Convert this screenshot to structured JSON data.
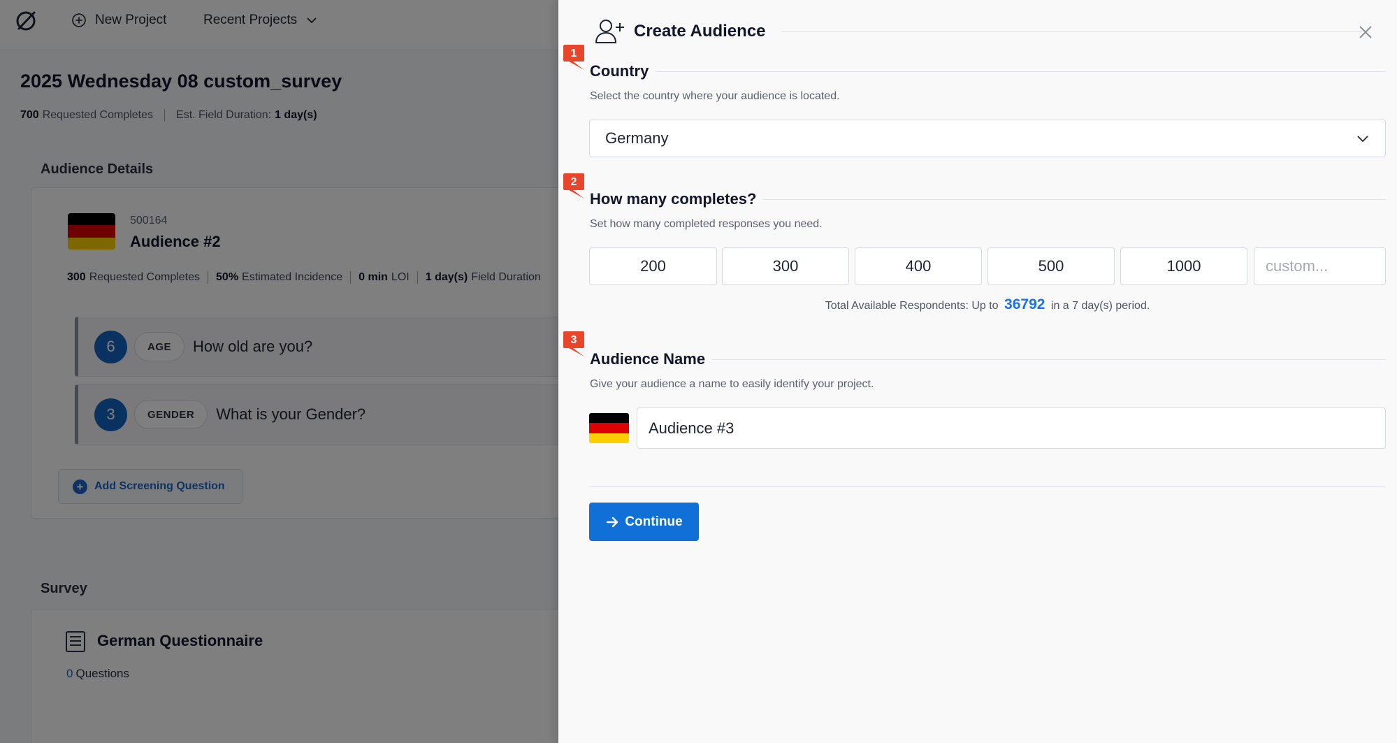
{
  "colors": {
    "primary": "#1070d8",
    "accent_number": "#1a73e8",
    "step_badge": "#e8462a",
    "overlay": "rgba(0,0,0,0.5)",
    "flag_black": "#000000",
    "flag_red": "#dd0000",
    "flag_gold": "#ffce00"
  },
  "topbar": {
    "logo_icon": "brand-logo-icon",
    "new_project_label": "New Project",
    "recent_projects_label": "Recent Projects"
  },
  "project": {
    "title": "2025 Wednesday 08 custom_survey",
    "requested_completes_value": "700",
    "requested_completes_label": "Requested Completes",
    "field_duration_label": "Est. Field Duration:",
    "field_duration_value": "1 day(s)"
  },
  "audience_details": {
    "section_label": "Audience Details",
    "id": "500164",
    "name": "Audience #2",
    "stats": [
      {
        "value": "300",
        "label": "Requested Completes"
      },
      {
        "value": "50%",
        "label": "Estimated Incidence"
      },
      {
        "value": "0 min",
        "label": "LOI"
      },
      {
        "value": "1 day(s)",
        "label": "Field Duration"
      }
    ],
    "questions": [
      {
        "count": "6",
        "tag": "AGE",
        "text": "How old are you?"
      },
      {
        "count": "3",
        "tag": "GENDER",
        "text": "What is your Gender?"
      }
    ],
    "add_question_label": "Add Screening Question"
  },
  "survey": {
    "section_label": "Survey",
    "name": "German Questionnaire",
    "question_count": "0",
    "question_label": "Questions"
  },
  "drawer": {
    "title": "Create Audience",
    "steps": [
      {
        "number": "1",
        "title": "Country",
        "description": "Select the country where your audience is located."
      },
      {
        "number": "2",
        "title": "How many completes?",
        "description": "Set how many completed responses you need."
      },
      {
        "number": "3",
        "title": "Audience Name",
        "description": "Give your audience a name to easily identify your project."
      }
    ],
    "country_value": "Germany",
    "complete_options": [
      "200",
      "300",
      "400",
      "500",
      "1000"
    ],
    "custom_placeholder": "custom...",
    "available": {
      "prefix": "Total Available Respondents: Up to",
      "count": "36792",
      "suffix": "in a 7 day(s) period."
    },
    "audience_name_value": "Audience #3",
    "continue_label": "Continue"
  }
}
